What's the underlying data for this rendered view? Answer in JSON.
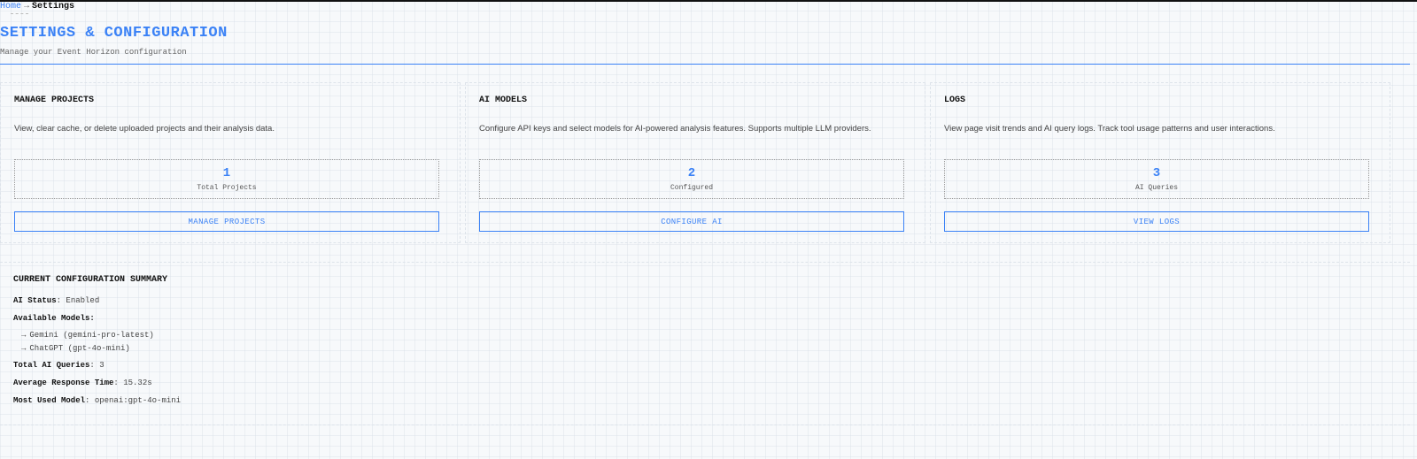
{
  "breadcrumb": {
    "home": "Home",
    "separator": "→",
    "current": "Settings"
  },
  "header": {
    "title": "SETTINGS & CONFIGURATION",
    "subtitle": "Manage your Event Horizon configuration"
  },
  "cards": [
    {
      "title": "MANAGE PROJECTS",
      "description": "View, clear cache, or delete uploaded projects and their analysis data.",
      "stat_value": "1",
      "stat_label": "Total Projects",
      "button": "MANAGE PROJECTS"
    },
    {
      "title": "AI MODELS",
      "description": "Configure API keys and select models for AI-powered analysis features. Supports multiple LLM providers.",
      "stat_value": "2",
      "stat_label": "Configured",
      "button": "CONFIGURE AI"
    },
    {
      "title": "LOGS",
      "description": "View page visit trends and AI query logs. Track tool usage patterns and user interactions.",
      "stat_value": "3",
      "stat_label": "AI Queries",
      "button": "VIEW LOGS"
    }
  ],
  "summary": {
    "title": "CURRENT CONFIGURATION SUMMARY",
    "ai_status_label": "AI Status",
    "ai_status_value": "Enabled",
    "models_label": "Available Models:",
    "models_arrow": "→",
    "models": [
      "Gemini (gemini-pro-latest)",
      "ChatGPT (gpt-4o-mini)"
    ],
    "total_queries_label": "Total AI Queries",
    "total_queries_value": "3",
    "avg_response_label": "Average Response Time",
    "avg_response_value": "15.32s",
    "most_used_label": "Most Used Model",
    "most_used_value": "openai:gpt-4o-mini",
    "colon": ":"
  },
  "colors": {
    "accent": "#3b82f6",
    "text": "#222222",
    "muted": "#666666",
    "background": "#f7f9fb"
  }
}
